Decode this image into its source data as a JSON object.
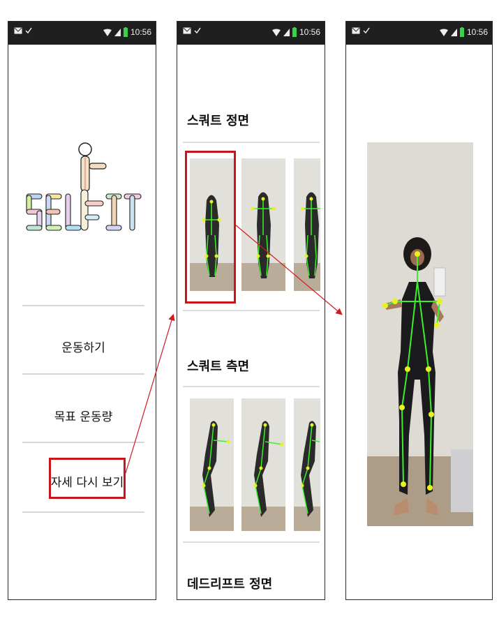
{
  "status_bar": {
    "time": "10:56"
  },
  "screen1": {
    "logo_text": "SELFIT",
    "menu": [
      {
        "label": "운동하기"
      },
      {
        "label": "목표 운동량"
      },
      {
        "label": "자세 다시 보기"
      }
    ]
  },
  "screen2": {
    "sections": [
      {
        "title": "스쿼트 정면"
      },
      {
        "title": "스쿼트 측면"
      },
      {
        "title": "데드리프트 정면"
      }
    ]
  },
  "colors": {
    "highlight": "#c8161d",
    "skeleton": "#3cf02a",
    "joint": "#e8f21d"
  }
}
